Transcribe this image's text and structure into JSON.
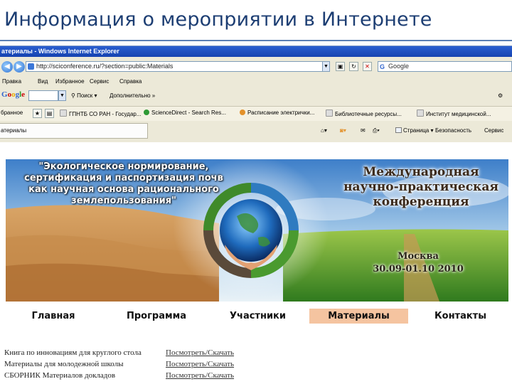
{
  "slide": {
    "title": "Информация о мероприятии в Интернете"
  },
  "browser": {
    "window_title": "атериалы - Windows Internet Explorer",
    "url": "http://sciconference.ru/?section=public:Materials",
    "search_placeholder": "Google",
    "menu": [
      "Правка",
      "Вид",
      "Избранное",
      "Сервис",
      "Справка"
    ],
    "google_toolbar": {
      "logo": "Google",
      "search_label": "Поиск",
      "more_label": "Дополнительно »"
    },
    "favorites": [
      "бранное",
      "ГПНТБ СО РАН - Государ...",
      "ScienceDirect - Search Res...",
      "Расписание электрички...",
      "Библиотечные ресурсы...",
      "Институт медицинской..."
    ],
    "tab_label": "атериалы",
    "commands": [
      "Страница",
      "Безопасность",
      "Сервис"
    ]
  },
  "banner": {
    "left_text": "\"Экологическое нормирование, сертификация и паспортизация почв как научная основа рационального землепользования\"",
    "right_text": "Международная научно-практическая конференция",
    "city": "Москва",
    "date": "30.09-01.10 2010"
  },
  "site_nav": [
    "Главная",
    "Программа",
    "Участники",
    "Материалы",
    "Контакты"
  ],
  "site_nav_active": "Материалы",
  "documents": [
    {
      "title": "Книга по инновациям для круглого стола",
      "link": "Посмотреть/Скачать"
    },
    {
      "title": "Материалы для молодежной школы",
      "link": "Посмотреть/Скачать"
    },
    {
      "title": "СБОРНИК Материалов докладов",
      "link": "Посмотреть/Скачать"
    }
  ],
  "colors": {
    "title": "#1d3e73",
    "active_tab": "#f5c4a0",
    "ie_titlebar": "#2a5fd0"
  }
}
